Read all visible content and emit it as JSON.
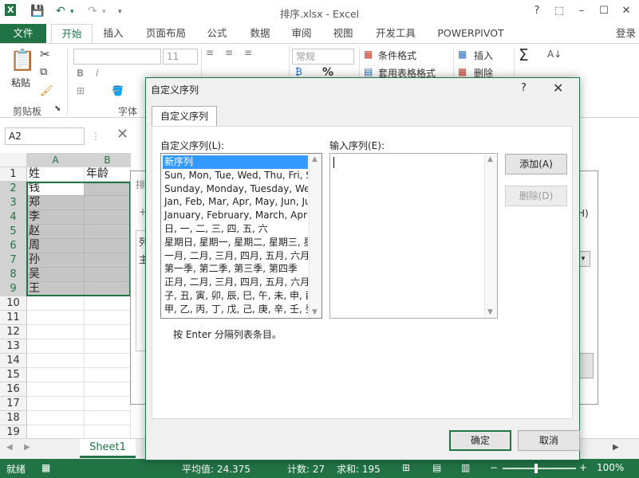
{
  "window": {
    "title": "排序.xlsx - Excel",
    "min": "–",
    "restore": "☐",
    "close": "✕",
    "help": "?"
  },
  "ribbon_tabs": [
    "文件",
    "开始",
    "插入",
    "页面布局",
    "公式",
    "数据",
    "审阅",
    "视图",
    "开发工具",
    "POWERPIVOT"
  ],
  "ribbon_active_tab": "开始",
  "login": "登录",
  "ribbon": {
    "paste": "粘贴",
    "clipboard_group": "剪贴板",
    "font_group": "字体",
    "font_size": "11",
    "bold": "B",
    "italic": "I",
    "number_format": "常规",
    "percent": "%",
    "cond_format": "条件格式",
    "table_format": "套用表格格式",
    "insert": "插入",
    "delete": "删除",
    "sigma": "Σ"
  },
  "formula_bar": {
    "name_box": "A2"
  },
  "grid": {
    "columns": [
      "A",
      "B"
    ],
    "rows": [
      "1",
      "2",
      "3",
      "4",
      "5",
      "6",
      "7",
      "8",
      "9",
      "10",
      "11",
      "12",
      "13",
      "14",
      "15",
      "16",
      "17",
      "18",
      "19"
    ],
    "header_row": [
      "姓",
      "年龄"
    ],
    "names": [
      "钱",
      "郑",
      "李",
      "赵",
      "周",
      "孙",
      "吴",
      "王"
    ]
  },
  "sheet_tab": "Sheet1",
  "status": {
    "ready": "就绪",
    "average": "平均值: 24.375",
    "count": "计数: 27",
    "sum": "求和: 195",
    "zoom": "100%"
  },
  "background_dialog": {
    "title_fragment": "排",
    "col_label": "列",
    "main_label": "主",
    "shortcut": "H)"
  },
  "dialog": {
    "title": "自定义序列",
    "tab": "自定义序列",
    "list_label": "自定义序列(L):",
    "entries_label": "输入序列(E):",
    "items": [
      "新序列",
      "Sun, Mon, Tue, Wed, Thu, Fri, Sat",
      "Sunday, Monday, Tuesday, Wednesday",
      "Jan, Feb, Mar, Apr, May, Jun, Jul",
      "January, February, March, April",
      "日, 一, 二, 三, 四, 五, 六",
      "星期日, 星期一, 星期二, 星期三, 星期",
      "一月, 二月, 三月, 四月, 五月, 六月,",
      "第一季, 第二季, 第三季, 第四季",
      "正月, 二月, 三月, 四月, 五月, 六月,",
      "子, 丑, 寅, 卯, 辰, 巳, 午, 未, 申, 酉",
      "甲, 乙, 丙, 丁, 戊, 己, 庚, 辛, 壬, 癸"
    ],
    "add_button": "添加(A)",
    "delete_button": "删除(D)",
    "hint": "按 Enter 分隔列表条目。",
    "ok_button": "确定",
    "cancel_button": "取消"
  },
  "colors": {
    "accent": "#217346",
    "selection": "#3399ff"
  }
}
